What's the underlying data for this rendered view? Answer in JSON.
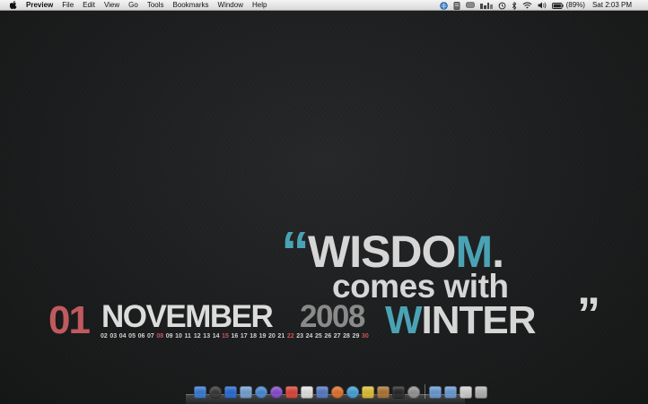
{
  "menubar": {
    "app_name": "Preview",
    "menus": [
      "File",
      "Edit",
      "View",
      "Go",
      "Tools",
      "Bookmarks",
      "Window",
      "Help"
    ],
    "battery": "(89%)",
    "clock": "Sat 2:03 PM"
  },
  "wallpaper": {
    "open_quote": "“",
    "wisdom_main": "WISDO",
    "wisdom_accent": "M",
    "wisdom_dot": ".",
    "comes_with": "comes with",
    "day": "01",
    "month": "NOVEMBER",
    "year": "2008",
    "winter_accent": "W",
    "winter_main": "INTER",
    "close_quote": "”",
    "dates": [
      "02",
      "03",
      "04",
      "05",
      "06",
      "07",
      "08",
      "09",
      "10",
      "11",
      "12",
      "13",
      "14",
      "15",
      "16",
      "17",
      "18",
      "19",
      "20",
      "21",
      "22",
      "23",
      "24",
      "25",
      "26",
      "27",
      "28",
      "29",
      "30"
    ],
    "highlighted_dates": [
      "08",
      "15",
      "22",
      "30"
    ]
  },
  "colors": {
    "accent_teal": "#4aa3b5",
    "accent_red": "#bf5a5e",
    "text_light": "#d6d6d6",
    "year_gray": "#8a8a8a",
    "background": "#1b1c1d"
  },
  "dock": {
    "apps": [
      {
        "icon": "finder-icon",
        "color": "#3c7fd6"
      },
      {
        "icon": "dashboard-icon",
        "color": "#3a3a3a"
      },
      {
        "icon": "app-store-icon",
        "color": "#2e6fd8"
      },
      {
        "icon": "mail-icon",
        "color": "#7aa7d8"
      },
      {
        "icon": "safari-icon",
        "color": "#4b8fd9"
      },
      {
        "icon": "ichat-icon",
        "color": "#8b4fd1"
      },
      {
        "icon": "gmail-icon",
        "color": "#e04a3f"
      },
      {
        "icon": "ical-icon",
        "color": "#e9e9e9"
      },
      {
        "icon": "xcode-icon",
        "color": "#5a7fc9"
      },
      {
        "icon": "firefox-icon",
        "color": "#e8772e"
      },
      {
        "icon": "itunes-icon",
        "color": "#4aa7dd"
      },
      {
        "icon": "stickies-icon",
        "color": "#e5c43a"
      },
      {
        "icon": "photo-icon",
        "color": "#b07a3a"
      },
      {
        "icon": "terminal-icon",
        "color": "#2a2a2a"
      },
      {
        "icon": "system-preferences-icon",
        "color": "#9a9a9a"
      }
    ],
    "stacks": [
      {
        "icon": "applications-folder-icon",
        "color": "#6fa0d8"
      },
      {
        "icon": "downloads-folder-icon",
        "color": "#6fa0d8"
      },
      {
        "icon": "documents-stack-icon",
        "color": "#d8d8d8"
      },
      {
        "icon": "trash-icon",
        "color": "#bcbcbc"
      }
    ]
  }
}
